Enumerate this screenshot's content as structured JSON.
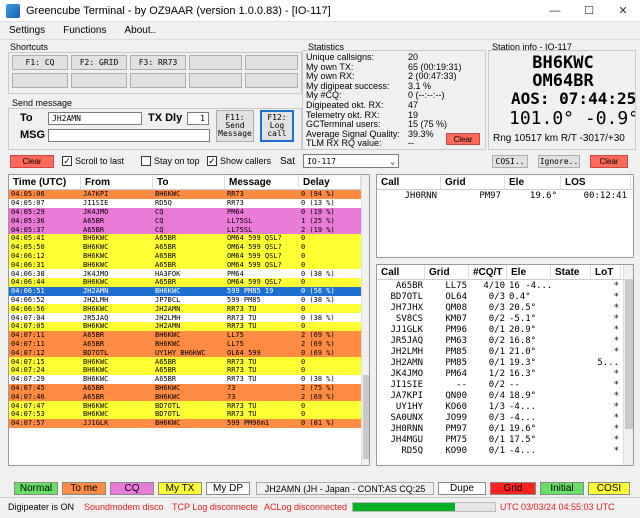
{
  "window": {
    "title": "Greencube Terminal  - by OZ9AAR (version 1.0.0.83) - [IO-117]",
    "minimize": "—",
    "maximize": "☐",
    "close": "✕"
  },
  "menu": [
    "Settings",
    "Functions",
    "About.."
  ],
  "shortcuts": {
    "label": "Shortcuts",
    "buttons": [
      "F1: CQ",
      "F2: GRID",
      "F3: RR73",
      "",
      "",
      "",
      "",
      "",
      "",
      ""
    ]
  },
  "send": {
    "label": "Send message",
    "to_label": "To",
    "to_value": "JH2AMN",
    "msg_label": "MSG",
    "tx_dly_label": "TX Dly",
    "tx_dly_value": "1",
    "f11": "F11: Send Message",
    "f12": "F12: Log call"
  },
  "controls": {
    "clear": "Clear",
    "scroll_to_last": "Scroll to last",
    "stay_on_top": "Stay on top",
    "show_callers": "Show callers",
    "sat_label": "Sat",
    "sat_value": "IO-117",
    "cosi": "COSI..",
    "ignore": "Ignore..",
    "clear2": "Clear",
    "clear3": "Clear"
  },
  "statistics": {
    "label": "Statistics",
    "rows": [
      [
        "Unique callsigns:",
        "20"
      ],
      [
        "My own TX:",
        "65  (00:19:31)"
      ],
      [
        "My own RX:",
        "2  (00:47:33)"
      ],
      [
        "My digipeat success:",
        "3.1 %"
      ],
      [
        "My #CQ:",
        "0  (--:--:--)"
      ],
      [
        "Digipeated okt. RX:",
        "47"
      ],
      [
        "Telemetry okt. RX:",
        "19"
      ],
      [
        "GCTerminal users:",
        "15 (75 %)"
      ],
      [
        "Average Signal Quality:",
        "39.3%"
      ],
      [
        "TLM RX RQ value:",
        "--"
      ]
    ]
  },
  "station_info": {
    "label": "Station info - IO-117",
    "call": "BH6KWC",
    "grid": "OM64BR",
    "aos": "AOS: 07:44:25 z",
    "az_el": "101.0°  -0.9°",
    "rng": "Rng 10517 km R/T -3017/+30"
  },
  "messages": {
    "headers": [
      "Time (UTC)",
      "From",
      "To",
      "Message",
      "Delay"
    ],
    "rows": [
      [
        "04:05:06",
        "JA7KPI",
        "BH6KWC",
        "RR73",
        "0 (94 %)",
        "#ff8c42"
      ],
      [
        "04:05:07",
        "JI1SIE",
        "RD5Q",
        "RR73",
        "0 (13 %)",
        "#ffffff"
      ],
      [
        "04:05:29",
        "JK4JMO",
        "CQ",
        "PM64",
        "0 (19 %)",
        "#e87ad8"
      ],
      [
        "04:05:36",
        "A65BR",
        "CQ",
        "LL75SL",
        "1 (25 %)",
        "#e87ad8"
      ],
      [
        "04:05:37",
        "A65BR",
        "CQ",
        "LL75SL",
        "2 (19 %)",
        "#e87ad8"
      ],
      [
        "04:05:41",
        "BH6KWC",
        "A65BR",
        "OM64 599 QSL?",
        "0",
        "#ffff33"
      ],
      [
        "04:05:50",
        "BH6KWC",
        "A65BR",
        "OM64 599 QSL?",
        "0",
        "#ffff33"
      ],
      [
        "04:06:12",
        "BH6KWC",
        "A65BR",
        "OM64 599 QSL?",
        "0",
        "#ffff33"
      ],
      [
        "04:06:31",
        "BH6KWC",
        "A65BR",
        "OM64 599 QSL?",
        "0",
        "#ffff33"
      ],
      [
        "04:06:38",
        "JK4JMO",
        "HA3FOK",
        "PM64",
        "0 (38 %)",
        "#ffffff"
      ],
      [
        "04:06:44",
        "BH6KWC",
        "A65BR",
        "OM64 599 QSL?",
        "0",
        "#ffff33"
      ],
      [
        "04:06:51",
        "JH2AMN",
        "BH6KWC",
        "599 PM85 19",
        "0 (56 %)",
        "#1e6fd0"
      ],
      [
        "04:06:52",
        "JH2LMH",
        "JP7BCL",
        "599 PM85",
        "0 (38 %)",
        "#ffffff"
      ],
      [
        "04:06:56",
        "BH6KWC",
        "JH2AMN",
        "RR73 TU",
        "0",
        "#ffff33"
      ],
      [
        "04:07:04",
        "JR5JAQ",
        "JH2LMH",
        "RR73 TU",
        "0 (38 %)",
        "#ffffff"
      ],
      [
        "04:07:05",
        "BH6KWC",
        "JH2AMN",
        "RR73 TU",
        "0",
        "#ffff33"
      ],
      [
        "04:07:11",
        "A65BR",
        "BH6KWC",
        "LL75",
        "2 (69 %)",
        "#ff8c42"
      ],
      [
        "04:07:11",
        "A65BR",
        "BH6KWC",
        "LL75",
        "2 (69 %)",
        "#ff8c42"
      ],
      [
        "04:07:12",
        "BD7OTL",
        "UY1HY BH6KWC",
        "OL64 599",
        "0 (69 %)",
        "#ff8c42"
      ],
      [
        "04:07:15",
        "BH6KWC",
        "A65BR",
        "RR73 TU",
        "0",
        "#ffff33"
      ],
      [
        "04:07:24",
        "BH6KWC",
        "A65BR",
        "RR73 TU",
        "0",
        "#ffff33"
      ],
      [
        "04:07:29",
        "BH6KWC",
        "A65BR",
        "RR73 TU",
        "0 (38 %)",
        "#ffffff"
      ],
      [
        "04:07:45",
        "A65BR",
        "BH6KWC",
        "73",
        "2 (75 %)",
        "#ff8c42"
      ],
      [
        "04:07:46",
        "A65BR",
        "BH6KWC",
        "73",
        "2 (69 %)",
        "#ff8c42"
      ],
      [
        "04:07:47",
        "BH6KWC",
        "BD7OTL",
        "RR73 TU",
        "0",
        "#ffff33"
      ],
      [
        "04:07:53",
        "BH6KWC",
        "BD7OTL",
        "RR73 TU",
        "0",
        "#ffff33"
      ],
      [
        "04:07:57",
        "JJ1GLK",
        "BH6KWC",
        "599 PM96m1",
        "0 (81 %)",
        "#ff8c42"
      ]
    ]
  },
  "tracking": {
    "headers": [
      "Call",
      "Grid",
      "Ele",
      "LOS"
    ],
    "rows": [
      [
        "JH0RNN",
        "PM97",
        "19.6°",
        "00:12:41"
      ]
    ]
  },
  "callers": {
    "headers": [
      "Call",
      "Grid",
      "#CQ/T",
      "Ele",
      "State",
      "LoT"
    ],
    "rows": [
      [
        "A65BR",
        "LL75",
        "4/10",
        "16  -4..."
      ],
      [
        "BD7OTL",
        "OL64",
        "0/3",
        "0.4°"
      ],
      [
        "JH7JHX",
        "QM08",
        "0/3",
        "20.5°"
      ],
      [
        "SV8CS",
        "KM07",
        "0/2",
        "-5.1°"
      ],
      [
        "JJ1GLK",
        "PM96",
        "0/1",
        "20.9°"
      ],
      [
        "JR5JAQ",
        "PM63",
        "0/2",
        "16.8°"
      ],
      [
        "JH2LMH",
        "PM85",
        "0/1",
        "21.0°"
      ],
      [
        "JH2AMN",
        "PM85",
        "0/1",
        "19.3°"
      ],
      [
        "JK4JMO",
        "PM64",
        "1/2",
        "16.3°"
      ],
      [
        "JI1SIE",
        "--",
        "0/2",
        "--"
      ],
      [
        "JA7KPI",
        "QN00",
        "0/4",
        "18.9°"
      ],
      [
        "UY1HY",
        "KO60",
        "1/3",
        "-4..."
      ],
      [
        "SA0UNX",
        "JO99",
        "0/3",
        "-4..."
      ],
      [
        "JH0RNN",
        "PM97",
        "0/1",
        "19.6°"
      ],
      [
        "JH4MGU",
        "PM75",
        "0/1",
        "17.5°"
      ],
      [
        "RD5Q",
        "KO90",
        "0/1",
        "-4..."
      ]
    ],
    "marks": [
      "*",
      "*",
      "*",
      "*",
      "*",
      "*",
      "*",
      "5...",
      "*",
      "*",
      "*",
      "*",
      "*",
      "*",
      "*",
      "*"
    ]
  },
  "modes": {
    "normal": "Normal",
    "tome": "To me",
    "cq": "CQ",
    "mytx": "My TX",
    "mydp": "My DP",
    "info": "JH2AMN (JH - Japan - CONT:AS CQ:25",
    "dupe": "Dupe",
    "grid": "Grid",
    "initial": "Initial",
    "cosi": "COSI"
  },
  "status": {
    "digi": "Digipeater is ON",
    "soundmodem": "Soundmodem disco",
    "tcplog": "TCP Log disconnecte",
    "aclog": "ACLog disconnected",
    "utc": "UTC 03/03/24 04:55:03 UTC",
    "progress": 0.72
  }
}
